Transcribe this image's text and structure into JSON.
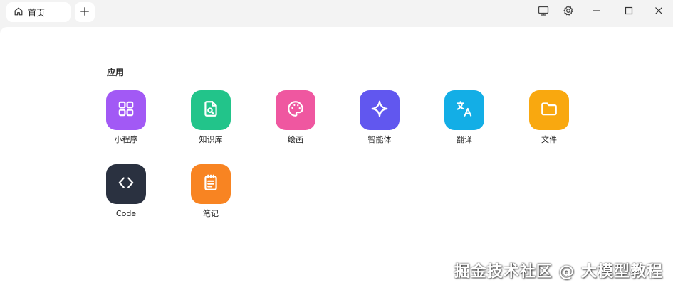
{
  "tabs": [
    {
      "label": "首页",
      "icon": "home-icon"
    }
  ],
  "window_controls": [
    "monitor-icon",
    "gear-icon",
    "minimize-icon",
    "maximize-icon",
    "close-icon"
  ],
  "main": {
    "section_title": "应用",
    "apps": [
      {
        "label": "小程序",
        "icon": "grid-icon",
        "color": "#a259f5"
      },
      {
        "label": "知识库",
        "icon": "document-search-icon",
        "color": "#22c48a"
      },
      {
        "label": "绘画",
        "icon": "palette-icon",
        "color": "#ef57a0"
      },
      {
        "label": "智能体",
        "icon": "sparkle-icon",
        "color": "#6157ef"
      },
      {
        "label": "翻译",
        "icon": "translate-icon",
        "color": "#13aee6"
      },
      {
        "label": "文件",
        "icon": "folder-icon",
        "color": "#f9a80f"
      },
      {
        "label": "Code",
        "icon": "code-icon",
        "color": "#2a3140"
      },
      {
        "label": "笔记",
        "icon": "notepad-icon",
        "color": "#f88422"
      }
    ]
  },
  "watermark": "掘金技术社区 @ 大模型教程"
}
